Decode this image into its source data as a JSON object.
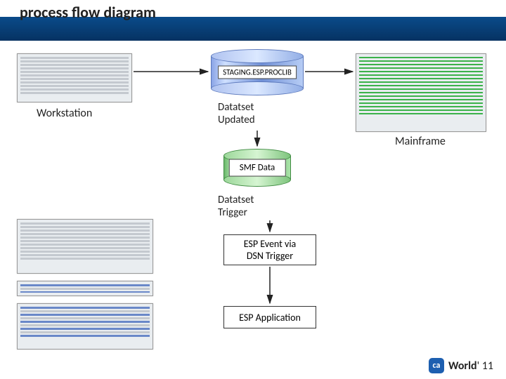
{
  "title": "process flow diagram",
  "labels": {
    "workstation": "Workstation",
    "mainframe": "Mainframe",
    "dataset_updated": "Datatset\nUpdated",
    "dataset_trigger": "Datatset\nTrigger"
  },
  "cylinders": {
    "staging": "STAGING.ESP.PROCLIB",
    "smf": "SMF Data"
  },
  "boxes": {
    "esp_event": "ESP Event via\nDSN Trigger",
    "esp_app": "ESP Application"
  },
  "logo": {
    "badge": "ca",
    "text_prefix": "World",
    "text_suffix": "' 11"
  }
}
